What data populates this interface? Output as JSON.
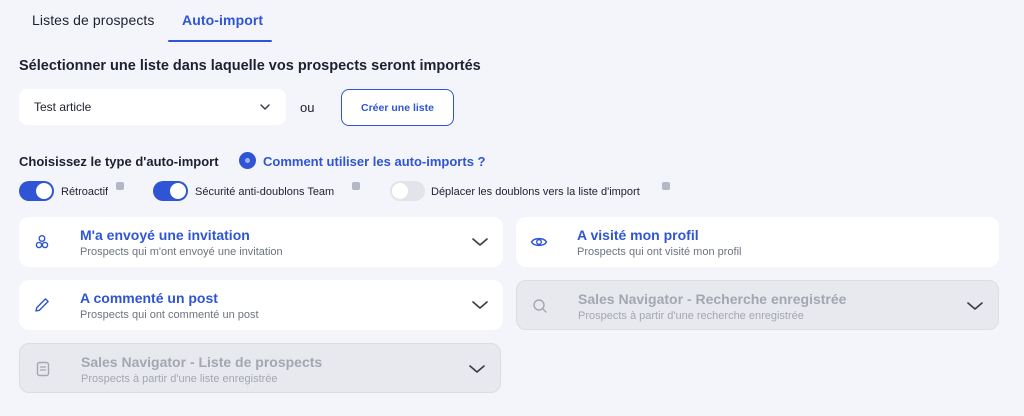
{
  "tabs": [
    {
      "label": "Listes de prospects",
      "active": false
    },
    {
      "label": "Auto-import",
      "active": true
    }
  ],
  "list_section": {
    "title": "Sélectionner une liste dans laquelle vos prospects seront importés",
    "selected_list": "Test article",
    "or_label": "ou",
    "create_button": "Créer une liste"
  },
  "type_section": {
    "title": "Choisissez le type d'auto-import",
    "help_link": "Comment utiliser les auto-imports ?"
  },
  "options": [
    {
      "label": "Rétroactif",
      "enabled": true
    },
    {
      "label": "Sécurité anti-doublons Team",
      "enabled": true
    },
    {
      "label": "Déplacer les doublons vers la liste d'import",
      "enabled": false
    }
  ],
  "import_types": [
    {
      "title": "M'a envoyé une invitation",
      "subtitle": "Prospects qui m'ont envoyé une invitation",
      "icon": "users-icon",
      "disabled": false
    },
    {
      "title": "A visité mon profil",
      "subtitle": "Prospects qui ont visité mon profil",
      "icon": "eye-icon",
      "disabled": false
    },
    {
      "title": "A commenté un post",
      "subtitle": "Prospects qui ont commenté un post",
      "icon": "pencil-icon",
      "disabled": false
    },
    {
      "title": "Sales Navigator - Recherche enregistrée",
      "subtitle": "Prospects à partir d'une recherche enregistrée",
      "icon": "search-icon",
      "disabled": true
    },
    {
      "title": "Sales Navigator - Liste de prospects",
      "subtitle": "Prospects à partir d'une liste enregistrée",
      "icon": "document-icon",
      "disabled": true
    }
  ],
  "colors": {
    "accent": "#2f55d4",
    "background": "#f3f5fa",
    "disabled_card": "#e8e9ee"
  }
}
